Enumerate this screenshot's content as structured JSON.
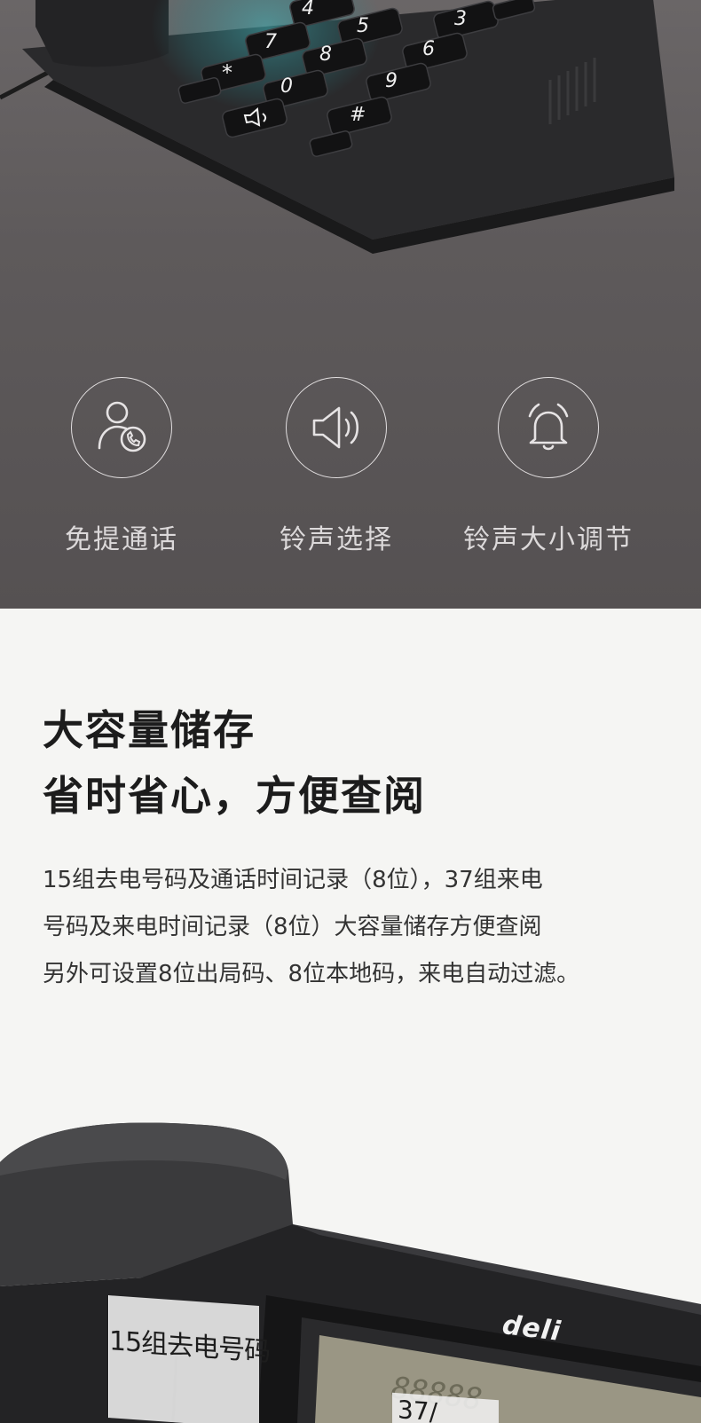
{
  "phone_keys": {
    "k4": "4",
    "k5": "5",
    "k3": "3",
    "k7": "7",
    "k8": "8",
    "k6": "6",
    "kstar": "*",
    "k0": "0",
    "k9": "9",
    "khash": "#"
  },
  "features": [
    {
      "icon": "handsfree-call-icon",
      "label": "免提通话"
    },
    {
      "icon": "speaker-icon",
      "label": "铃声选择"
    },
    {
      "icon": "bell-icon",
      "label": "铃声大小调节"
    }
  ],
  "headline": {
    "line1": "大容量储存",
    "line2": "省时省心，方便查阅"
  },
  "description": {
    "line1": "15组去电号码及通话时间记录（8位），37组来电",
    "line2": "号码及来电时间记录（8位）大容量储存方便查阅",
    "line3": "另外可设置8位出局码、8位本地码，来电自动过滤。"
  },
  "callouts": {
    "outgoing": "15组去电号码",
    "incoming_partial": "37/"
  },
  "brand": "deli",
  "colors": {
    "top_background": "#5e5a5b",
    "page_background": "#f5f5f3",
    "accent_teal": "#2c8a90"
  }
}
